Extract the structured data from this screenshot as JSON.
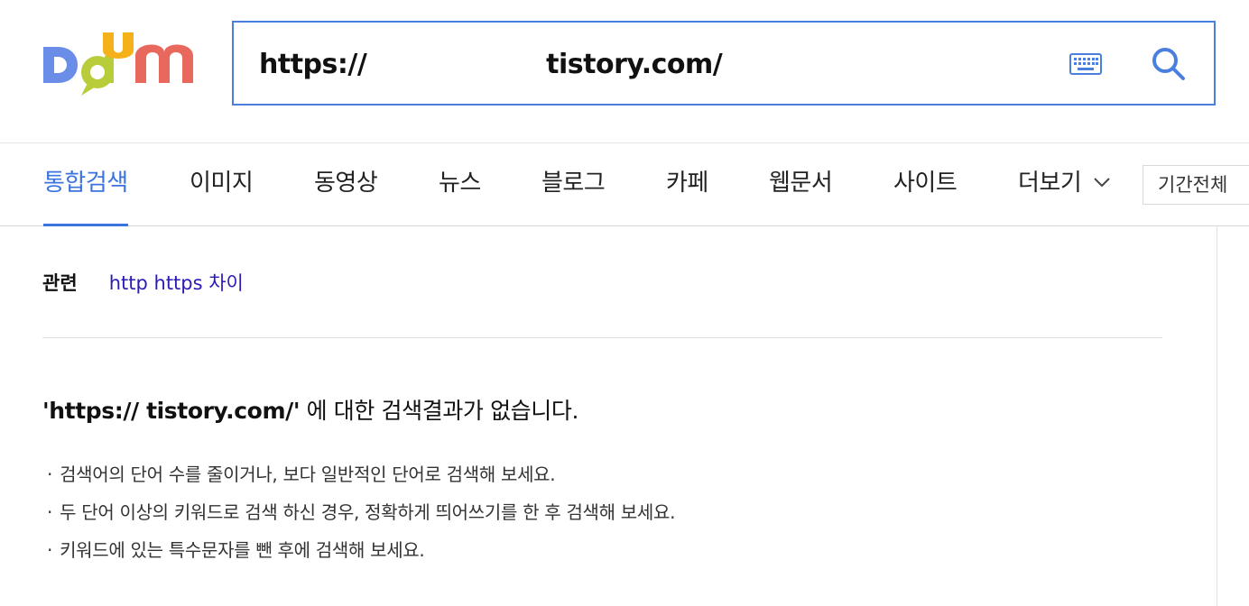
{
  "logo": {
    "text": "Daum",
    "colors": [
      "#6a8de8",
      "#b9cc3a",
      "#f5b11a",
      "#e9685e"
    ]
  },
  "search": {
    "value": "https://                    tistory.com/",
    "keyboard_icon": "keyboard-icon",
    "search_icon": "search-icon",
    "accent": "#4a7fe0"
  },
  "tabs": [
    {
      "label": "통합검색",
      "active": true
    },
    {
      "label": "이미지"
    },
    {
      "label": "동영상"
    },
    {
      "label": "뉴스"
    },
    {
      "label": "블로그"
    },
    {
      "label": "카페"
    },
    {
      "label": "웹문서"
    },
    {
      "label": "사이트"
    },
    {
      "label": "더보기"
    }
  ],
  "period": {
    "label": "기간전체"
  },
  "related": {
    "label": "관련",
    "link": "http https 차이"
  },
  "result": {
    "query": "'https://                    tistory.com/'",
    "message": " 에 대한 검색결과가 없습니다."
  },
  "tips": [
    "검색어의 단어 수를 줄이거나, 보다 일반적인 단어로 검색해 보세요.",
    "두 단어 이상의 키워드로 검색 하신 경우, 정확하게 띄어쓰기를 한 후 검색해 보세요.",
    "키워드에 있는 특수문자를 뺀 후에 검색해 보세요."
  ]
}
